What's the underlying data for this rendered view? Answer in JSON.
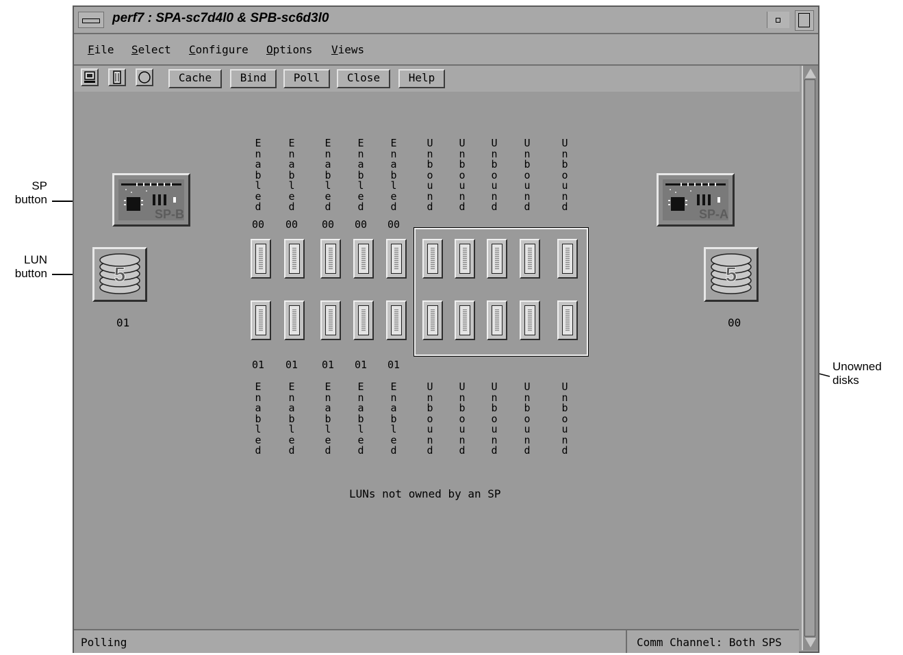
{
  "annotations": {
    "sp_button": [
      "SP",
      "button"
    ],
    "lun_button": [
      "LUN",
      "button"
    ],
    "unowned_disks": [
      "Unowned",
      "disks"
    ]
  },
  "window": {
    "title": "perf7 : SPA-sc7d4l0 & SPB-sc6d3l0"
  },
  "menu": [
    {
      "mnemonic": "F",
      "rest": "ile"
    },
    {
      "mnemonic": "S",
      "rest": "elect"
    },
    {
      "mnemonic": "C",
      "rest": "onfigure"
    },
    {
      "mnemonic": "O",
      "rest": "ptions"
    },
    {
      "mnemonic": "V",
      "rest": "iews"
    }
  ],
  "toolbar": {
    "icons": [
      "computer-icon",
      "chassis-icon",
      "circle-icon"
    ],
    "buttons": [
      "Cache",
      "Bind",
      "Poll",
      "Close",
      "Help"
    ]
  },
  "sp": {
    "b": {
      "label": "SP-B",
      "lun": "01"
    },
    "a": {
      "label": "SP-A",
      "lun": "00"
    },
    "raid_level": "5"
  },
  "top_row": {
    "states": [
      "Enabled",
      "Enabled",
      "Enabled",
      "Enabled",
      "Enabled",
      "Unbound",
      "Unbound",
      "Unbound",
      "Unbound",
      "Unbound"
    ],
    "numbers": [
      "00",
      "00",
      "00",
      "00",
      "00"
    ]
  },
  "bottom_row": {
    "numbers": [
      "01",
      "01",
      "01",
      "01",
      "01"
    ],
    "states": [
      "Enabled",
      "Enabled",
      "Enabled",
      "Enabled",
      "Enabled",
      "Unbound",
      "Unbound",
      "Unbound",
      "Unbound",
      "Unbound"
    ]
  },
  "caption": "LUNs not owned by an SP",
  "status": {
    "left": "Polling",
    "right": "Comm Channel: Both SPS"
  },
  "colors": {
    "window_bg": "#9a9a9a",
    "bar_bg": "#a8a8a8"
  }
}
